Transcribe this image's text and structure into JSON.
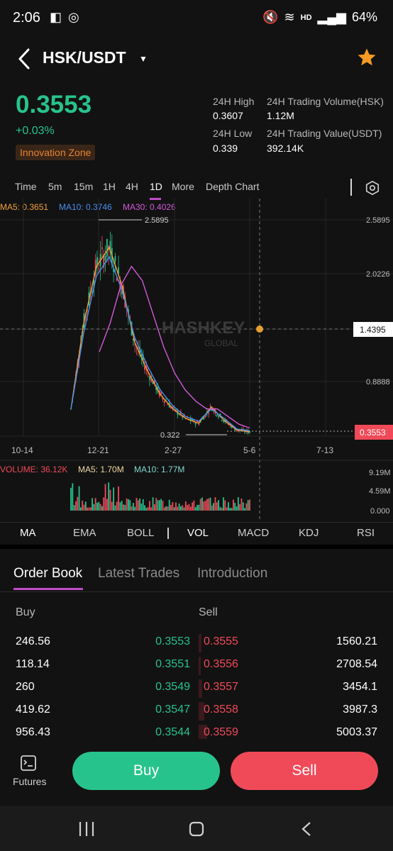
{
  "status_bar": {
    "time": "2:06",
    "battery": "64%",
    "hd_label": "HD"
  },
  "header": {
    "pair": "HSK/USDT"
  },
  "ticker": {
    "price": "0.3553",
    "change": "+0.03%",
    "zone": "Innovation Zone",
    "high_label": "24H High",
    "high_value": "0.3607",
    "low_label": "24H Low",
    "low_value": "0.339",
    "volume_label": "24H Trading Volume(HSK)",
    "volume_value": "1.12M",
    "value_label": "24H Trading Value(USDT)",
    "value_value": "392.14K"
  },
  "timeframes": [
    "Time",
    "5m",
    "15m",
    "1H",
    "4H",
    "1D",
    "More",
    "Depth Chart"
  ],
  "active_timeframe": "1D",
  "ma_legend": {
    "ma5": "MA5: 0.3651",
    "ma10": "MA10: 0.3746",
    "ma30": "MA30: 0.4026"
  },
  "volume_legend": {
    "volume": "VOLUME: 36.12K",
    "ma5": "MA5: 1.70M",
    "ma10": "MA10: 1.77M"
  },
  "watermark": {
    "brand": "HASHKEY",
    "sub": "GLOBAL"
  },
  "chart_data": {
    "type": "line",
    "price_axis": [
      "2.5895",
      "2.0226",
      "1.4395",
      "0.8888"
    ],
    "current_price_tag": "0.3553",
    "cursor_price_tag": "1.4395",
    "high_marker": "2.5895",
    "low_marker": "0.322",
    "x_ticks": [
      "10-14",
      "12-21",
      "2-27",
      "5-6",
      "7-13"
    ],
    "volume_axis": [
      "9.19M",
      "4.59M",
      "0.000"
    ],
    "series": [
      {
        "name": "MA5",
        "values": [
          0.6,
          1.5,
          2.1,
          2.3,
          1.9,
          1.3,
          1.0,
          0.75,
          0.6,
          0.5,
          0.45,
          0.62,
          0.48,
          0.38,
          0.36
        ]
      },
      {
        "name": "MA10",
        "values": [
          0.6,
          1.4,
          2.0,
          2.2,
          1.85,
          1.35,
          1.05,
          0.8,
          0.63,
          0.52,
          0.47,
          0.6,
          0.5,
          0.39,
          0.37
        ]
      },
      {
        "name": "MA30",
        "values": [
          1.2,
          1.5,
          1.9,
          2.1,
          1.95,
          1.6,
          1.25,
          0.98,
          0.8,
          0.68,
          0.6,
          0.6,
          0.52,
          0.44,
          0.4
        ]
      }
    ],
    "colors": {
      "ma5": "#f0a13a",
      "ma10": "#4a8df0",
      "ma30": "#d05ad8",
      "up": "#27c38c",
      "down": "#f04a59"
    }
  },
  "indicators": [
    "MA",
    "EMA",
    "BOLL",
    "VOL",
    "MACD",
    "KDJ",
    "RSI"
  ],
  "tabs": [
    "Order Book",
    "Latest Trades",
    "Introduction"
  ],
  "order_book": {
    "buy_label": "Buy",
    "sell_label": "Sell",
    "rows": [
      {
        "buy_qty": "246.56",
        "buy_price": "0.3553",
        "sell_price": "0.3555",
        "sell_qty": "1560.21"
      },
      {
        "buy_qty": "118.14",
        "buy_price": "0.3551",
        "sell_price": "0.3556",
        "sell_qty": "2708.54"
      },
      {
        "buy_qty": "260",
        "buy_price": "0.3549",
        "sell_price": "0.3557",
        "sell_qty": "3454.1"
      },
      {
        "buy_qty": "419.62",
        "buy_price": "0.3547",
        "sell_price": "0.3558",
        "sell_qty": "3987.3"
      },
      {
        "buy_qty": "956.43",
        "buy_price": "0.3544",
        "sell_price": "0.3559",
        "sell_qty": "5003.37"
      }
    ]
  },
  "bottom": {
    "futures_label": "Futures",
    "buy_button": "Buy",
    "sell_button": "Sell"
  },
  "colors": {
    "green": "#27c38c",
    "red": "#f04a59",
    "accent": "#c04cc8",
    "star": "#f59a23"
  }
}
